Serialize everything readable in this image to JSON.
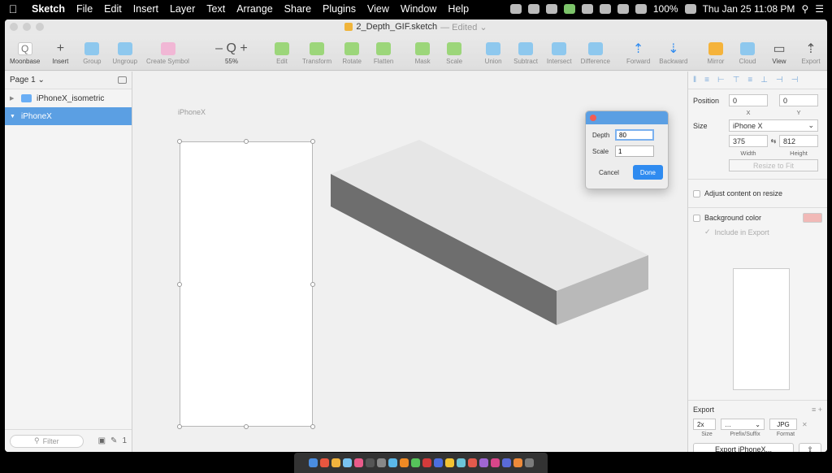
{
  "menubar": {
    "app": "Sketch",
    "items": [
      "File",
      "Edit",
      "Insert",
      "Layer",
      "Text",
      "Arrange",
      "Share",
      "Plugins",
      "View",
      "Window",
      "Help"
    ],
    "battery": "100%",
    "clock": "Thu Jan 25  11:08 PM"
  },
  "window": {
    "doc_name": "2_Depth_GIF.sketch",
    "doc_status": "— Edited ⌄"
  },
  "toolbar": {
    "left": [
      {
        "label": "Moonbase",
        "glyph": "Q"
      },
      {
        "label": "Insert",
        "glyph": "+"
      },
      {
        "label": "Group",
        "glyph": ""
      },
      {
        "label": "Ungroup",
        "glyph": ""
      },
      {
        "label": "Create Symbol",
        "glyph": ""
      },
      {
        "label": "55%",
        "glyph": "– Q +"
      },
      {
        "label": "Edit",
        "glyph": ""
      },
      {
        "label": "Transform",
        "glyph": ""
      },
      {
        "label": "Rotate",
        "glyph": ""
      },
      {
        "label": "Flatten",
        "glyph": ""
      },
      {
        "label": "Mask",
        "glyph": ""
      },
      {
        "label": "Scale",
        "glyph": ""
      },
      {
        "label": "Union",
        "glyph": ""
      },
      {
        "label": "Subtract",
        "glyph": ""
      },
      {
        "label": "Intersect",
        "glyph": ""
      },
      {
        "label": "Difference",
        "glyph": ""
      },
      {
        "label": "Forward",
        "glyph": "⇡"
      },
      {
        "label": "Backward",
        "glyph": "⇣"
      }
    ],
    "right": [
      {
        "label": "Mirror",
        "glyph": ""
      },
      {
        "label": "Cloud",
        "glyph": ""
      },
      {
        "label": "View",
        "glyph": "▭"
      },
      {
        "label": "Export",
        "glyph": "⇡"
      }
    ]
  },
  "layers": {
    "page": "Page 1 ⌄",
    "items": [
      {
        "name": "iPhoneX_isometric",
        "selected": false
      },
      {
        "name": "iPhoneX",
        "selected": true
      }
    ],
    "filter_placeholder": "Filter",
    "symbol_count": "1"
  },
  "canvas": {
    "artboard_label": "iPhoneX"
  },
  "dialog": {
    "depth_label": "Depth",
    "depth_value": "80",
    "scale_label": "Scale",
    "scale_value": "1",
    "cancel": "Cancel",
    "done": "Done"
  },
  "inspector": {
    "position_label": "Position",
    "x": "0",
    "x_label": "X",
    "y": "0",
    "y_label": "Y",
    "size_label": "Size",
    "size_preset": "iPhone X",
    "width": "375",
    "width_label": "Width",
    "height": "812",
    "height_label": "Height",
    "resize_to_fit": "Resize to Fit",
    "adjust_content": "Adjust content on resize",
    "background_color": "Background color",
    "include_in_export": "Include in Export",
    "background_swatch": "#f1b9b7"
  },
  "export": {
    "title": "Export",
    "size": "2x",
    "size_label": "Size",
    "prefix_label": "Prefix/Suffix",
    "format": "JPG",
    "format_label": "Format",
    "button": "Export iPhoneX..."
  }
}
